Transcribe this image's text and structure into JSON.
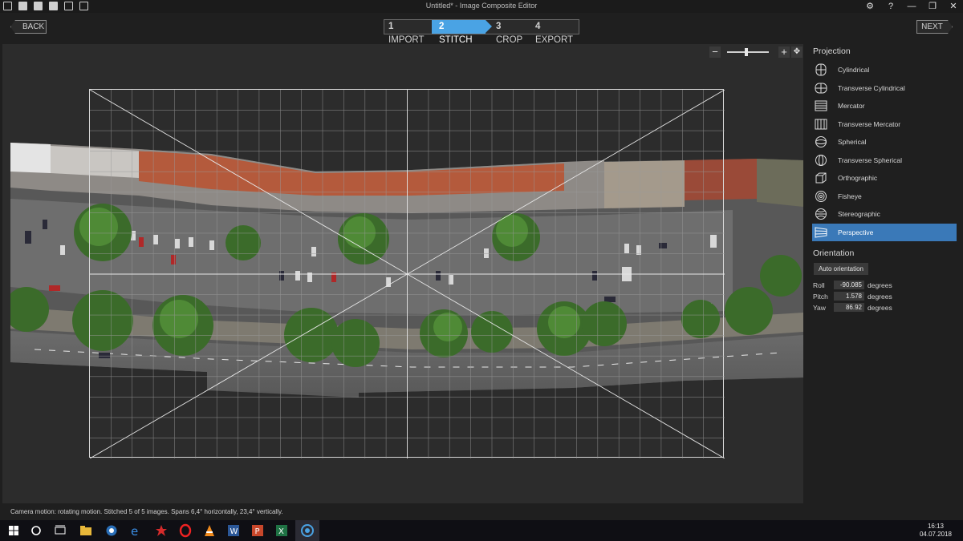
{
  "window": {
    "title": "Untitled* - Image Composite Editor"
  },
  "window_controls": {
    "settings_icon": "gear-icon",
    "help": "?",
    "minimize": "—",
    "restore": "❐",
    "close": "✕"
  },
  "nav": {
    "back_label": "BACK",
    "next_label": "NEXT",
    "steps": [
      {
        "num": "1",
        "label": "IMPORT"
      },
      {
        "num": "2",
        "label": "STITCH"
      },
      {
        "num": "3",
        "label": "CROP"
      },
      {
        "num": "4",
        "label": "EXPORT"
      }
    ],
    "active_step": 1
  },
  "zoom": {
    "minus": "−",
    "plus": "+",
    "level": 0.45
  },
  "projection": {
    "heading": "Projection",
    "items": [
      {
        "label": "Cylindrical",
        "icon": "cylindrical-icon"
      },
      {
        "label": "Transverse Cylindrical",
        "icon": "transverse-cylindrical-icon"
      },
      {
        "label": "Mercator",
        "icon": "mercator-icon"
      },
      {
        "label": "Transverse Mercator",
        "icon": "transverse-mercator-icon"
      },
      {
        "label": "Spherical",
        "icon": "spherical-icon"
      },
      {
        "label": "Transverse Spherical",
        "icon": "transverse-spherical-icon"
      },
      {
        "label": "Orthographic",
        "icon": "orthographic-icon"
      },
      {
        "label": "Fisheye",
        "icon": "fisheye-icon"
      },
      {
        "label": "Stereographic",
        "icon": "stereographic-icon"
      },
      {
        "label": "Perspective",
        "icon": "perspective-icon"
      }
    ],
    "selected": "Perspective"
  },
  "orientation": {
    "heading": "Orientation",
    "auto_label": "Auto orientation",
    "roll": {
      "label": "Roll",
      "value": "-90.085",
      "unit": "degrees"
    },
    "pitch": {
      "label": "Pitch",
      "value": "1.578",
      "unit": "degrees"
    },
    "yaw": {
      "label": "Yaw",
      "value": "86.92",
      "unit": "degrees"
    }
  },
  "status": "Camera motion: rotating motion. Stitched 5 of 5 images. Spans 6,4° horizontally, 23,4° vertically.",
  "taskbar": {
    "time": "16:13",
    "date": "04.07.2018"
  },
  "colors": {
    "accent": "#4aa3e4",
    "selected": "#3a79b8"
  }
}
